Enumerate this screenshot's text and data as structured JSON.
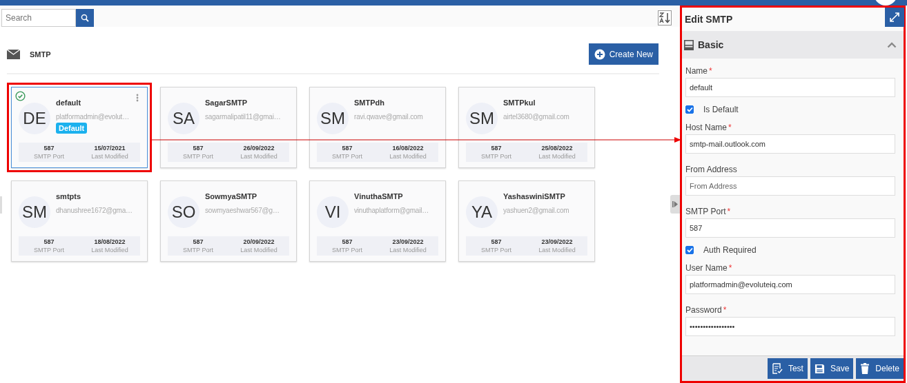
{
  "search": {
    "placeholder": "Search"
  },
  "section": {
    "title": "SMTP",
    "create_button": "Create New"
  },
  "cards": [
    {
      "initials": "DE",
      "name": "default",
      "email": "platformadmin@evolut…",
      "badge": "Default",
      "selected": true,
      "port": "587",
      "port_label": "SMTP Port",
      "modified": "15/07/2021",
      "modified_label": "Last Modified"
    },
    {
      "initials": "SA",
      "name": "SagarSMTP",
      "email": "sagarmalipatil11@gmai…",
      "selected": false,
      "port": "587",
      "port_label": "SMTP Port",
      "modified": "26/09/2022",
      "modified_label": "Last Modified"
    },
    {
      "initials": "SM",
      "name": "SMTPdh",
      "email": "ravi.qwave@gmail.com",
      "selected": false,
      "port": "587",
      "port_label": "SMTP Port",
      "modified": "16/08/2022",
      "modified_label": "Last Modified"
    },
    {
      "initials": "SM",
      "name": "SMTPkul",
      "email": "airtel3680@gmail.com",
      "selected": false,
      "port": "587",
      "port_label": "SMTP Port",
      "modified": "25/08/2022",
      "modified_label": "Last Modified"
    },
    {
      "initials": "SM",
      "name": "smtpts",
      "email": "dhanushree1672@gma…",
      "selected": false,
      "port": "587",
      "port_label": "SMTP Port",
      "modified": "18/08/2022",
      "modified_label": "Last Modified"
    },
    {
      "initials": "SO",
      "name": "SowmyaSMTP",
      "email": "sowmyaeshwar567@g…",
      "selected": false,
      "port": "587",
      "port_label": "SMTP Port",
      "modified": "20/09/2022",
      "modified_label": "Last Modified"
    },
    {
      "initials": "VI",
      "name": "VinuthaSMTP",
      "email": "vinuthaplatform@gmail…",
      "selected": false,
      "port": "587",
      "port_label": "SMTP Port",
      "modified": "23/09/2022",
      "modified_label": "Last Modified"
    },
    {
      "initials": "YA",
      "name": "YashaswiniSMTP",
      "email": "yashuen2@gmail.com",
      "selected": false,
      "port": "587",
      "port_label": "SMTP Port",
      "modified": "23/09/2022",
      "modified_label": "Last Modified"
    }
  ],
  "panel": {
    "title": "Edit SMTP",
    "section": {
      "title": "Basic",
      "expanded": true
    },
    "fields": [
      {
        "kind": "text",
        "label": "Name",
        "required_mark": "*",
        "value": "default"
      },
      {
        "kind": "checkbox",
        "label": "Is Default",
        "checked": true
      },
      {
        "kind": "text",
        "label": "Host Name",
        "required_mark": "*",
        "value": "smtp-mail.outlook.com"
      },
      {
        "kind": "text",
        "label": "From Address",
        "placeholder": "From Address"
      },
      {
        "kind": "text",
        "label": "SMTP Port",
        "required_mark": "*",
        "value": "587"
      },
      {
        "kind": "checkbox",
        "label": "Auth Required",
        "checked": true
      },
      {
        "kind": "text",
        "label": "User Name",
        "required_mark": "*",
        "value": "platformadmin@evoluteiq.com"
      },
      {
        "kind": "text",
        "label": "Password",
        "required_mark": "*",
        "value": "•••••••••••••••••"
      }
    ],
    "buttons": [
      {
        "kind": "test",
        "label": "Test"
      },
      {
        "kind": "save",
        "label": "Save"
      },
      {
        "kind": "delete",
        "label": "Delete"
      }
    ]
  }
}
